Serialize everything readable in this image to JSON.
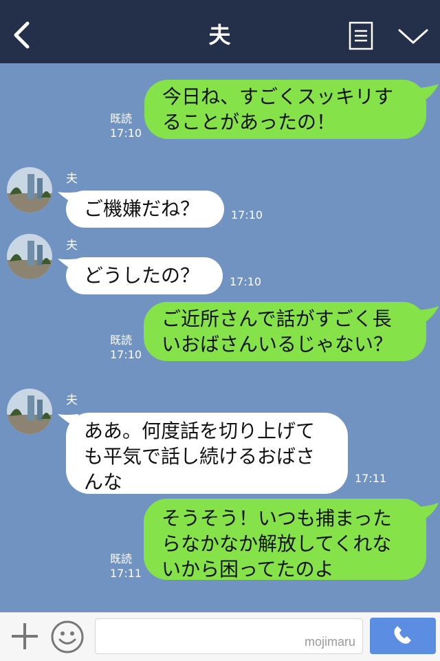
{
  "header": {
    "title": "夫"
  },
  "messages": [
    {
      "type": "sent",
      "text_lines": [
        "今日ね、すごくスッキリす",
        "ることがあったの！"
      ],
      "read": "既読",
      "time": "17:10"
    },
    {
      "type": "received",
      "sender": "夫",
      "text_lines": [
        "ご機嫌だね？"
      ],
      "time": "17:10"
    },
    {
      "type": "received",
      "sender": "夫",
      "text_lines": [
        "どうしたの？"
      ],
      "time": "17:10"
    },
    {
      "type": "sent",
      "text_lines": [
        "ご近所さんで話がすごく長",
        "いおばさんいるじゃない？"
      ],
      "read": "既読",
      "time": "17:10"
    },
    {
      "type": "received",
      "sender": "夫",
      "text_lines": [
        "ああ。何度話を切り上げて",
        "も平気で話し続けるおばさ",
        "んな"
      ],
      "time": "17:11"
    },
    {
      "type": "sent",
      "text_lines": [
        "そうそう！いつも捕まった",
        "らなかなか解放してくれな",
        "いから困ってたのよ"
      ],
      "read": "既読",
      "time": "17:11"
    }
  ],
  "footer": {
    "watermark": "mojimaru",
    "input_value": ""
  },
  "icons": {
    "back": "chevron-left-icon",
    "menu": "menu-icon",
    "collapse": "chevron-down-icon",
    "plus": "plus-icon",
    "emoji": "smiley-icon",
    "call": "phone-icon"
  },
  "colors": {
    "background": "#7193c1",
    "header": "#24304a",
    "sent_bubble": "#85e249",
    "received_bubble": "#ffffff",
    "call_button": "#5b8ee2"
  }
}
